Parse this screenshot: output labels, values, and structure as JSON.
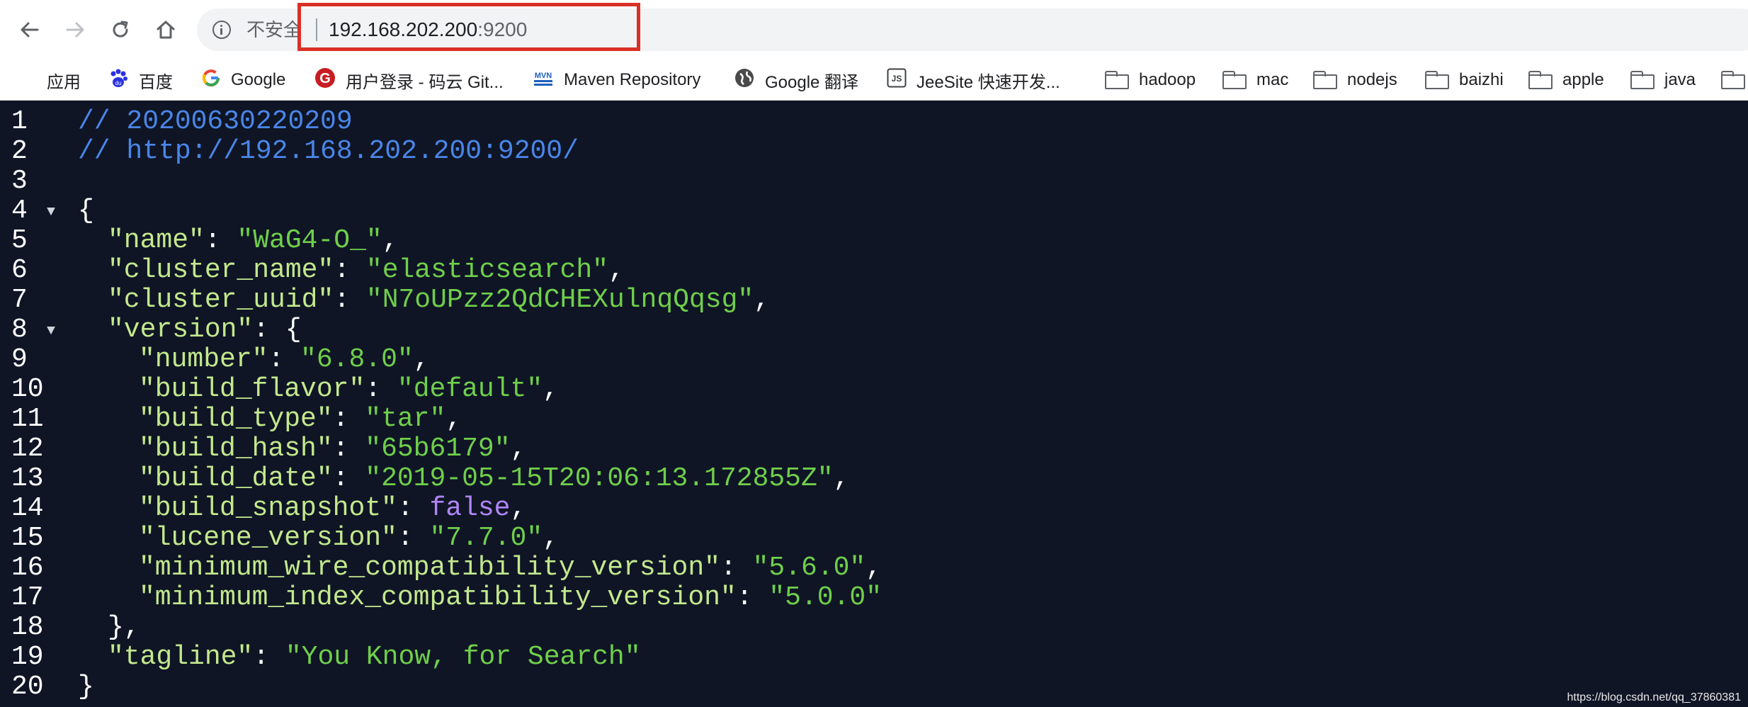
{
  "browser": {
    "security_label": "不安全",
    "url_host": "192.168.202.200",
    "url_port": ":9200"
  },
  "bookmarks": [
    {
      "label": "应用",
      "icon": "apps-grid-icon"
    },
    {
      "label": "百度",
      "icon": "baidu-paw-icon"
    },
    {
      "label": "Google",
      "icon": "google-g-icon"
    },
    {
      "label": "用户登录 - 码云 Git...",
      "icon": "gitee-icon"
    },
    {
      "label": "Maven Repository",
      "icon": "mvn-icon"
    },
    {
      "label": "Google 翻译",
      "icon": "globe-icon"
    },
    {
      "label": "JeeSite 快速开发...",
      "icon": "js-icon"
    },
    {
      "label": "hadoop",
      "icon": "folder-icon"
    },
    {
      "label": "mac",
      "icon": "folder-icon"
    },
    {
      "label": "nodejs",
      "icon": "folder-icon"
    },
    {
      "label": "baizhi",
      "icon": "folder-icon"
    },
    {
      "label": "apple",
      "icon": "folder-icon"
    },
    {
      "label": "java",
      "icon": "folder-icon"
    }
  ],
  "editor": {
    "comment_timestamp": "// 20200630220209",
    "comment_url": "// http://192.168.202.200:9200/",
    "fields": {
      "name": "WaG4-O_",
      "cluster_name": "elasticsearch",
      "cluster_uuid": "N7oUPzz2QdCHEXulnqQqsg",
      "number": "6.8.0",
      "build_flavor": "default",
      "build_type": "tar",
      "build_hash": "65b6179",
      "build_date": "2019-05-15T20:06:13.172855Z",
      "build_snapshot": "false",
      "lucene_version": "7.7.0",
      "minimum_wire_compatibility_version": "5.6.0",
      "minimum_index_compatibility_version": "5.0.0",
      "tagline": "You Know, for Search"
    }
  },
  "watermark": "https://blog.csdn.net/qq_37860381",
  "colors": {
    "editor_bg": "#0f1525",
    "comment": "#4a86e8",
    "key": "#c3e88d",
    "string": "#6fcf4b",
    "boolean": "#b084f5",
    "highlight_box": "#d93025"
  }
}
